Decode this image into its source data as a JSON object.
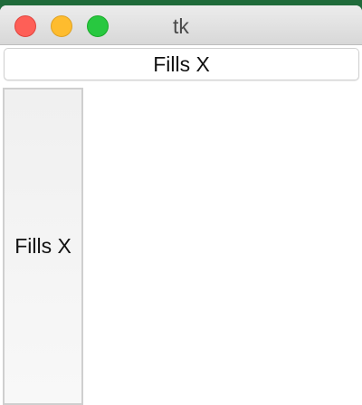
{
  "window": {
    "title": "tk"
  },
  "buttons": {
    "top_label": "Fills X",
    "side_label": "Fills X"
  },
  "colors": {
    "close": "#fe5f57",
    "minimize": "#febc2e",
    "zoom": "#28c840",
    "desktop": "#1f6b3a"
  },
  "icons": {
    "close": "close-icon",
    "minimize": "minimize-icon",
    "zoom": "zoom-icon"
  }
}
